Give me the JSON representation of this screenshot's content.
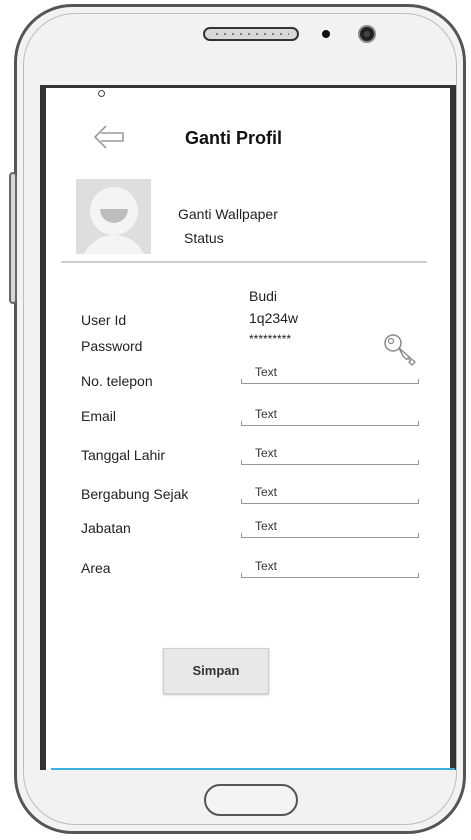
{
  "header": {
    "title": "Ganti Profil",
    "back_icon": "back-arrow-icon"
  },
  "profile": {
    "wallpaper_label": "Ganti Wallpaper",
    "status_label": "Status",
    "name": "Budi"
  },
  "account": {
    "userid_label": "User Id",
    "userid_value": "1q234w",
    "password_label": "Password",
    "password_value": "*********",
    "key_icon": "key-icon"
  },
  "fields": [
    {
      "label": "No. telepon",
      "placeholder": "Text"
    },
    {
      "label": "Email",
      "placeholder": "Text"
    },
    {
      "label": "Tanggal Lahir",
      "placeholder": "Text"
    },
    {
      "label": "Bergabung Sejak",
      "placeholder": "Text"
    },
    {
      "label": "Jabatan",
      "placeholder": "Text"
    },
    {
      "label": "Area",
      "placeholder": "Text"
    }
  ],
  "actions": {
    "save_label": "Simpan"
  },
  "colors": {
    "accent_line": "#3ab0dd",
    "button_bg": "#e8e8e8"
  }
}
